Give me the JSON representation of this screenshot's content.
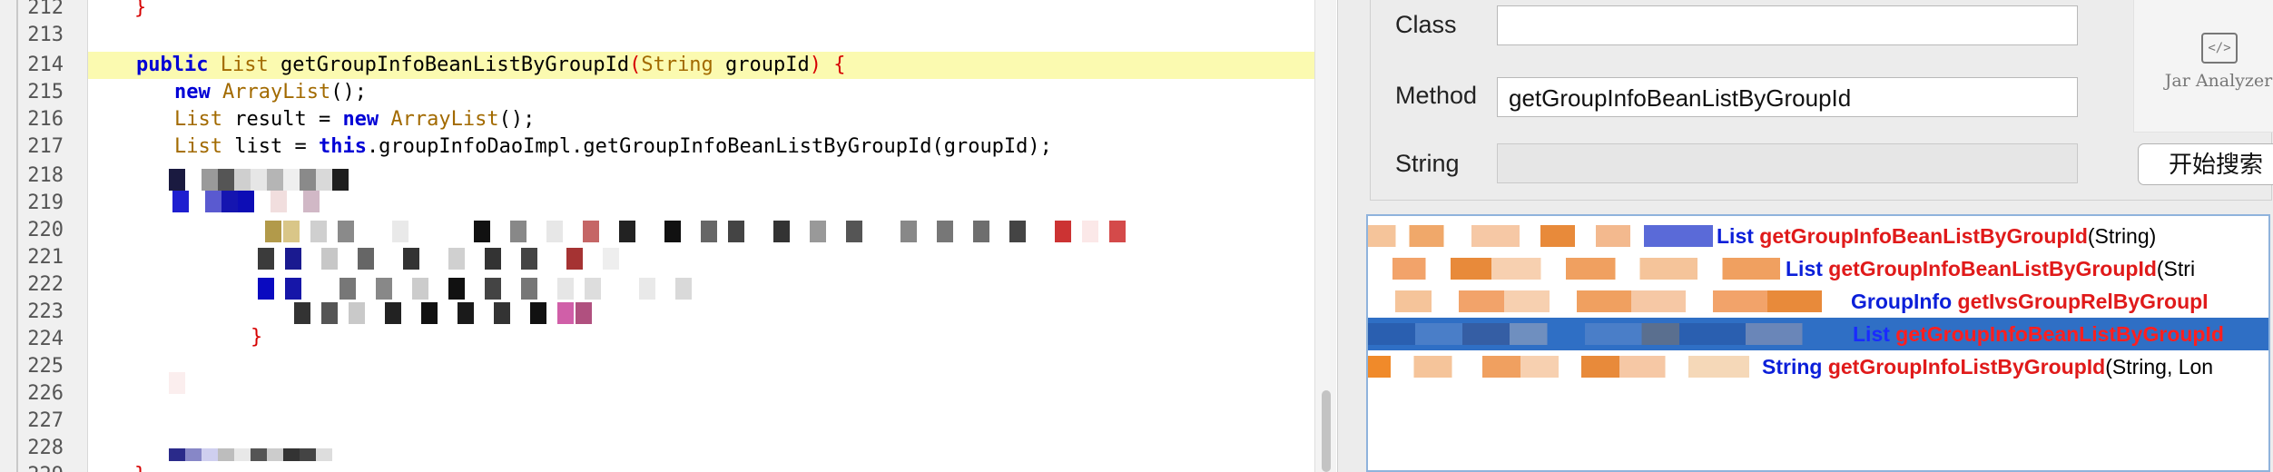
{
  "editor": {
    "line_numbers": [
      "212",
      "213",
      "214",
      "215",
      "216",
      "217",
      "218",
      "219",
      "220",
      "221",
      "222",
      "223",
      "224",
      "225",
      "226",
      "227",
      "228",
      "229"
    ],
    "line_212": "}",
    "line_214": {
      "kw": "public",
      "type": "List",
      "name": " getGroupInfoBeanListByGroupId",
      "paren_open": "(",
      "param_type": "String",
      "param": " groupId",
      "paren_close": ")",
      "brace": " {"
    },
    "line_215": {
      "kw": "new",
      "type": " ArrayList",
      "rest": "();"
    },
    "line_216": {
      "type": "List",
      "mid": " result = ",
      "kw": "new",
      "type2": " ArrayList",
      "rest": "();"
    },
    "line_217": {
      "type": "List",
      "mid": " list = ",
      "kw": "this",
      "rest": ".groupInfoDaoImpl.getGroupInfoBeanListByGroupId(groupId);"
    },
    "line_229": "}"
  },
  "panel": {
    "class_label": "Class",
    "class_value": "",
    "method_label": "Method",
    "method_value": "getGroupInfoBeanListByGroupId",
    "string_label": "String",
    "string_value": "",
    "search_button": "开始搜索",
    "logo_icon": "</>",
    "logo_text": "Jar Analyzer"
  },
  "results": [
    {
      "type": "List",
      "name": "getGroupInfoBeanListByGroupId",
      "sig": "(String)",
      "selected": false
    },
    {
      "type": "List",
      "name": "getGroupInfoBeanListByGroupId",
      "sig": "(Stri",
      "selected": false
    },
    {
      "type": "GroupInfo",
      "name": "getIvsGroupRelByGroupI",
      "sig": "",
      "selected": false
    },
    {
      "type": "List",
      "name": "getGroupInfoBeanListByGroupId",
      "sig": "",
      "selected": true
    },
    {
      "type": "String",
      "name": "getGroupInfoListByGroupId",
      "sig": "(String, Lon",
      "selected": false
    }
  ],
  "colors": {
    "keyword": "#0000d6",
    "type": "#a26a00",
    "brace": "#d60000",
    "current_line": "#fbfab0",
    "selection": "#2f6fc5",
    "result_type": "#0b1fd9",
    "result_name": "#e01a1a"
  }
}
